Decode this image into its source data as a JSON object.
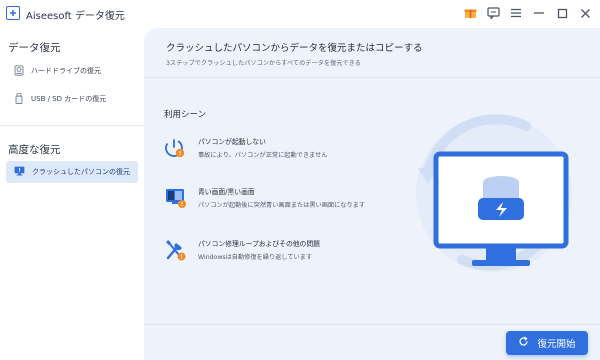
{
  "window": {
    "title": "Aiseesoft データ復元",
    "icons": [
      "gift-icon",
      "feedback-icon",
      "menu-icon",
      "minimize-icon",
      "maximize-icon",
      "close-icon"
    ]
  },
  "sidebar": {
    "section_recovery": "データ復元",
    "items": [
      {
        "label": "ハードドライブの復元",
        "icon": "hard-drive-icon"
      },
      {
        "label": "USB / SD カードの復元",
        "icon": "usb-sd-icon"
      }
    ],
    "section_advanced": "高度な復元",
    "advanced_items": [
      {
        "label": "クラッシュしたパソコンの復元",
        "icon": "crashed-pc-icon",
        "active": true
      }
    ]
  },
  "main": {
    "title": "クラッシュしたパソコンからデータを復元またはコピーする",
    "subtitle": "3ステップでクラッシュしたパソコンからすべてのデータを復元できる",
    "usage_title": "利用シーン",
    "cases": [
      {
        "title": "パソコンが起動しない",
        "desc": "事故により、パソコンが正常に起動できません",
        "icon": "power-error-icon"
      },
      {
        "title": "青い画面/黒い画面",
        "desc": "パソコンが起動後に突然青い画面または黒い画面になります",
        "icon": "screen-error-icon"
      },
      {
        "title": "パソコン修理ループおよびその他の問題",
        "desc": "Windowsは自動修復を繰り返しています",
        "icon": "repair-tools-icon"
      }
    ],
    "start_button": "復元開始"
  },
  "colors": {
    "accent": "#2f6fde",
    "sidebar_active_bg": "#dde8f9",
    "main_bg": "#eef3fb",
    "warning": "#f08a24"
  }
}
